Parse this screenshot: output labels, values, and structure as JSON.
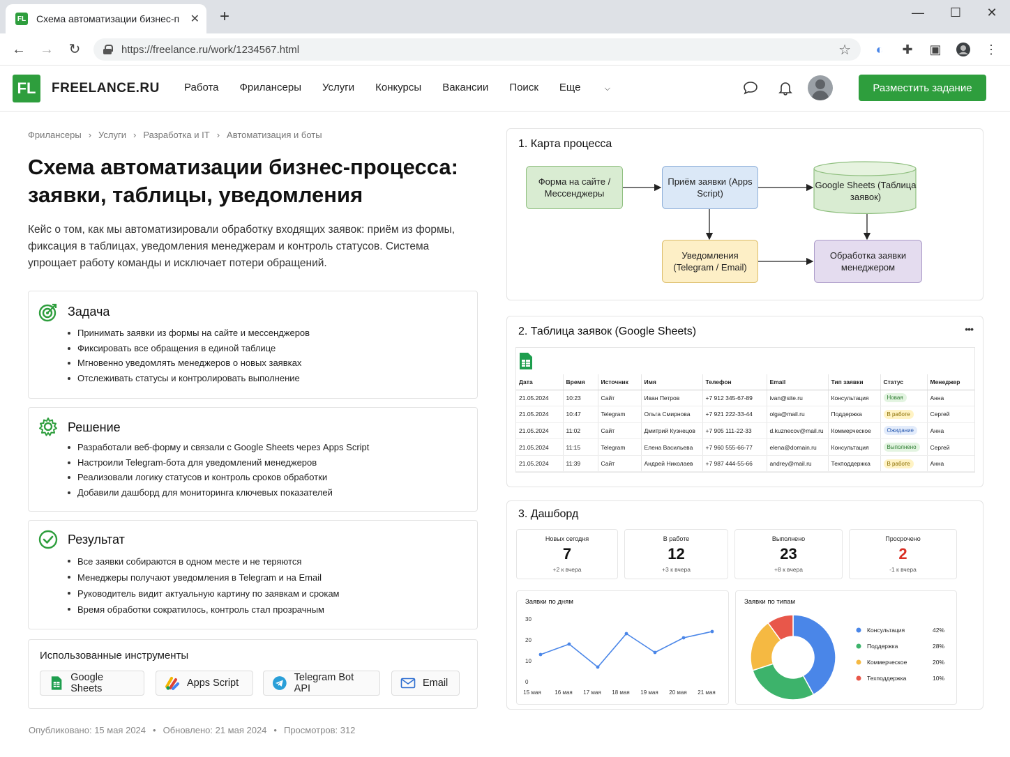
{
  "browser": {
    "tab_title": "Схема автоматизации бизнес-п",
    "favicon_text": "FL",
    "url": "https://freelance.ru/work/1234567.html"
  },
  "site": {
    "logo_mark": "FL",
    "logo_text": "FREELANCE.RU",
    "nav": [
      "Работа",
      "Фрилансеры",
      "Услуги",
      "Конкурсы",
      "Вакансии",
      "Поиск",
      "Еще"
    ],
    "cta": "Разместить задание"
  },
  "breadcrumb": [
    "Фрилансеры",
    "Услуги",
    "Разработка и IT",
    "Автоматизация и боты"
  ],
  "title_line1": "Схема автоматизации бизнес-процесса:",
  "title_line2": "заявки, таблицы, уведомления",
  "lead": "Кейс о том, как мы автоматизировали обработку входящих заявок: приём из формы, фиксация в таблицах, уведомления менеджерам и контроль статусов. Система упрощает работу команды и исключает потери обращений.",
  "task": {
    "title": "Задача",
    "items": [
      "Принимать заявки из формы на сайте и мессенджеров",
      "Фиксировать все обращения в единой таблице",
      "Мгновенно уведомлять менеджеров о новых заявках",
      "Отслеживать статусы и контролировать выполнение"
    ]
  },
  "solution": {
    "title": "Решение",
    "items": [
      "Разработали веб-форму и связали с Google Sheets через Apps Script",
      "Настроили Telegram-бота для уведомлений менеджеров",
      "Реализовали логику статусов и контроль сроков обработки",
      "Добавили дашборд для мониторинга ключевых показателей"
    ]
  },
  "result": {
    "title": "Результат",
    "items": [
      "Все заявки собираются в одном месте и не теряются",
      "Менеджеры получают уведомления в Telegram и на Email",
      "Руководитель видит актуальную картину по заявкам и срокам",
      "Время обработки сократилось, контроль стал прозрачным"
    ]
  },
  "tools": {
    "title": "Использованные инструменты",
    "items": [
      "Google Sheets",
      "Apps Script",
      "Telegram Bot API",
      "Email"
    ]
  },
  "meta": {
    "published": "Опубликовано: 15 мая 2024",
    "updated": "Обновлено: 21 мая 2024",
    "views": "Просмотров: 312"
  },
  "process_map": {
    "title": "1. Карта процесса",
    "nodes": {
      "form": "Форма на сайте / Мессенджеры",
      "intake": "Приём заявки (Apps Script)",
      "sheets": "Google Sheets (Таблица заявок)",
      "notify": "Уведомления (Telegram / Email)",
      "handle": "Обработка заявки менеджером"
    }
  },
  "sheet": {
    "title": "2. Таблица заявок (Google Sheets)",
    "menu": "•••",
    "columns": [
      "Дата",
      "Время",
      "Источник",
      "Имя",
      "Телефон",
      "Email",
      "Тип заявки",
      "Статус",
      "Менеджер"
    ],
    "rows": [
      [
        "21.05.2024",
        "10:23",
        "Сайт",
        "Иван Петров",
        "+7 912 345-67-89",
        "ivan@site.ru",
        "Консультация",
        "Новая",
        "Анна"
      ],
      [
        "21.05.2024",
        "10:47",
        "Telegram",
        "Ольга Смирнова",
        "+7 921 222-33-44",
        "olga@mail.ru",
        "Поддержка",
        "В работе",
        "Сергей"
      ],
      [
        "21.05.2024",
        "11:02",
        "Сайт",
        "Дмитрий Кузнецов",
        "+7 905 111-22-33",
        "d.kuznecov@mail.ru",
        "Коммерческое",
        "Ожидание",
        "Анна"
      ],
      [
        "21.05.2024",
        "11:15",
        "Telegram",
        "Елена Васильева",
        "+7 960 555-66-77",
        "elena@domain.ru",
        "Консультация",
        "Выполнено",
        "Сергей"
      ],
      [
        "21.05.2024",
        "11:39",
        "Сайт",
        "Андрей Николаев",
        "+7 987 444-55-66",
        "andrey@mail.ru",
        "Техподдержка",
        "В работе",
        "Анна"
      ]
    ],
    "status_colors": {
      "Новая": {
        "bg": "#e3f4e1",
        "fg": "#2e7d32"
      },
      "В работе": {
        "bg": "#fff3c4",
        "fg": "#8a6d00"
      },
      "Ожидание": {
        "bg": "#e3ecfb",
        "fg": "#2f5fb3"
      },
      "Выполнено": {
        "bg": "#e3f4e1",
        "fg": "#2e7d32"
      }
    }
  },
  "dashboard": {
    "title": "3. Дашборд",
    "kpis": [
      {
        "label": "Новых сегодня",
        "value": "7",
        "delta": "+2 к вчера"
      },
      {
        "label": "В работе",
        "value": "12",
        "delta": "+3 к вчера"
      },
      {
        "label": "Выполнено",
        "value": "23",
        "delta": "+8 к вчера"
      },
      {
        "label": "Просрочено",
        "value": "2",
        "delta": "-1 к вчера"
      }
    ],
    "line_title": "Заявки по дням",
    "donut_title": "Заявки по типам"
  },
  "chart_data": [
    {
      "type": "line",
      "title": "Заявки по дням",
      "categories": [
        "15 мая",
        "16 мая",
        "17 мая",
        "18 мая",
        "19 мая",
        "20 мая",
        "21 мая"
      ],
      "values": [
        13,
        18,
        7,
        23,
        14,
        21,
        24
      ],
      "yticks": [
        0,
        10,
        20,
        30
      ],
      "ylim": [
        0,
        30
      ],
      "color": "#4a86e8"
    },
    {
      "type": "pie",
      "title": "Заявки по типам",
      "labels": [
        "Консультация",
        "Поддержка",
        "Коммерческое",
        "Техподдержка"
      ],
      "values": [
        42,
        28,
        20,
        10
      ],
      "display": [
        "42%",
        "28%",
        "20%",
        "10%"
      ],
      "colors": [
        "#4a86e8",
        "#3db36b",
        "#f5b942",
        "#e8574a"
      ]
    }
  ]
}
